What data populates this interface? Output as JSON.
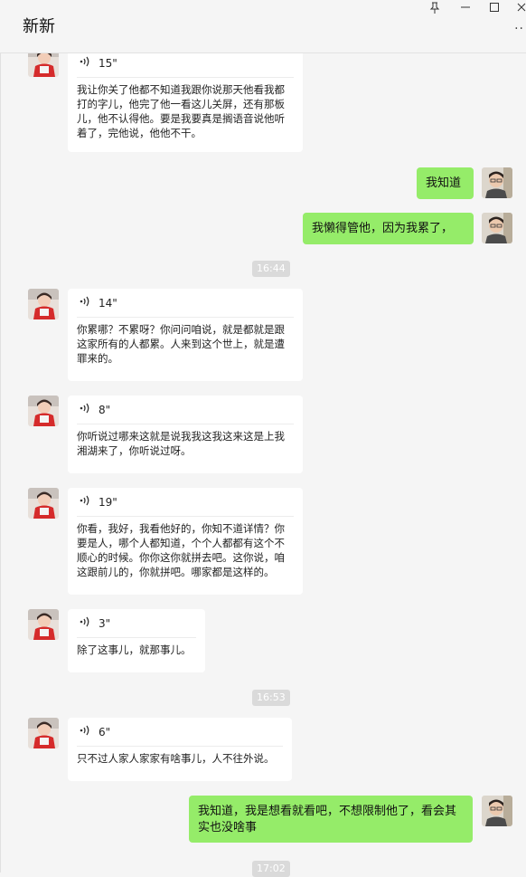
{
  "window": {
    "title": "新新",
    "pin_icon": "pin-icon",
    "minimize_icon": "minimize-icon",
    "maximize_icon": "maximize-icon",
    "close_icon": "close-icon",
    "more_icon": "more-icon"
  },
  "messages": {
    "m1": {
      "duration": "15\"",
      "text": "我让你关了他都不知道我跟你说那天他看我都打的字儿，他完了他一看这儿关屏，还有那板儿，他不认得他。要是我要真是搁语音说他听着了，完他说，他他不干。"
    },
    "m2": {
      "text": "我知道"
    },
    "m3": {
      "text": "我懒得管他，因为我累了，"
    },
    "t1": "16:44",
    "m4": {
      "duration": "14\"",
      "text": "你累哪？不累呀？你问问咱说，就是都就是跟这家所有的人都累。人来到这个世上，就是遭罪来的。"
    },
    "m5": {
      "duration": "8\"",
      "text": "你听说过哪来这就是说我我这我这来这是上我湘湖来了，你听说过呀。"
    },
    "m6": {
      "duration": "19\"",
      "text": "你看，我好，我看他好的，你知不道详情？你要是人，哪个人都知道，个个人都都有这个不顺心的时候。你你这你就拼去吧。这你说，咱这跟前儿的，你就拼吧。哪家都是这样的。"
    },
    "m7": {
      "duration": "3\"",
      "text": "除了这事儿，就那事儿。"
    },
    "t2": "16:53",
    "m8": {
      "duration": "6\"",
      "text": "只不过人家人家家有啥事儿，人不往外说。"
    },
    "m9": {
      "text": "我知道，我是想看就看吧，不想限制他了，看会其实也没啥事"
    },
    "t3": "17:02"
  },
  "icons": {
    "voice": "voice-wave-icon",
    "avatar_contact": "contact-avatar",
    "avatar_me": "my-avatar"
  },
  "colors": {
    "outgoing_bubble": "#95ec69",
    "incoming_bubble": "#ffffff",
    "background": "#f5f5f5",
    "timestamp_bg": "#dadada"
  }
}
